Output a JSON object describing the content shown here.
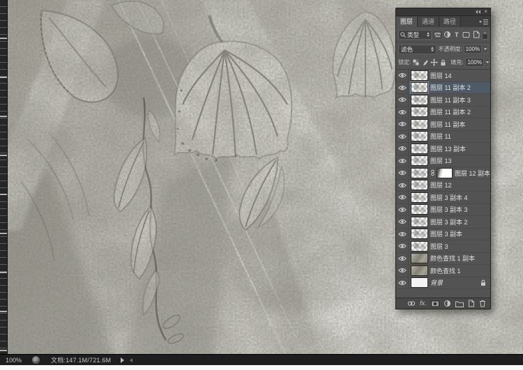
{
  "statusbar": {
    "zoom_value": "100%",
    "doc_label": "文档:147.1M/721.6M"
  },
  "panel": {
    "group": {
      "close_glyph": "×"
    },
    "tabs": {
      "layers": "图层",
      "channels": "通道",
      "paths": "路径"
    },
    "filter": {
      "kind_label": "类型",
      "type_glyph": "T"
    },
    "blend": {
      "mode": "滤色",
      "opacity_label": "不透明度:",
      "opacity_value": "100%"
    },
    "lock": {
      "lock_label": "锁定:",
      "fill_label": "填充:",
      "fill_value": "100%"
    },
    "footer": {
      "fx_label": "fx."
    },
    "layers": [
      {
        "name": "图层 14",
        "thumb": "checker"
      },
      {
        "name": "图层 11 副本 2",
        "thumb": "checker",
        "selected": true
      },
      {
        "name": "图层 11 副本 3",
        "thumb": "checker"
      },
      {
        "name": "图层 11 副本 2",
        "thumb": "checker"
      },
      {
        "name": "图层 11 副本",
        "thumb": "checker"
      },
      {
        "name": "图层 11",
        "thumb": "checker"
      },
      {
        "name": "图层 13 副本",
        "thumb": "checker"
      },
      {
        "name": "图层 13",
        "thumb": "checker"
      },
      {
        "name": "图层 12 副本",
        "thumb": "checker",
        "mask": true
      },
      {
        "name": "图层 12",
        "thumb": "checker"
      },
      {
        "name": "图层 3 副本 4",
        "thumb": "checker"
      },
      {
        "name": "图层 3 副本 3",
        "thumb": "checker"
      },
      {
        "name": "图层 3 副本 2",
        "thumb": "checker"
      },
      {
        "name": "图层 3 副本",
        "thumb": "checker"
      },
      {
        "name": "图层 3",
        "thumb": "checker"
      },
      {
        "name": "颜色查找 1 副本",
        "thumb": "texture"
      },
      {
        "name": "颜色查找 1",
        "thumb": "texture"
      },
      {
        "name": "背景",
        "thumb": "white",
        "locked": true,
        "italic": true
      }
    ]
  }
}
